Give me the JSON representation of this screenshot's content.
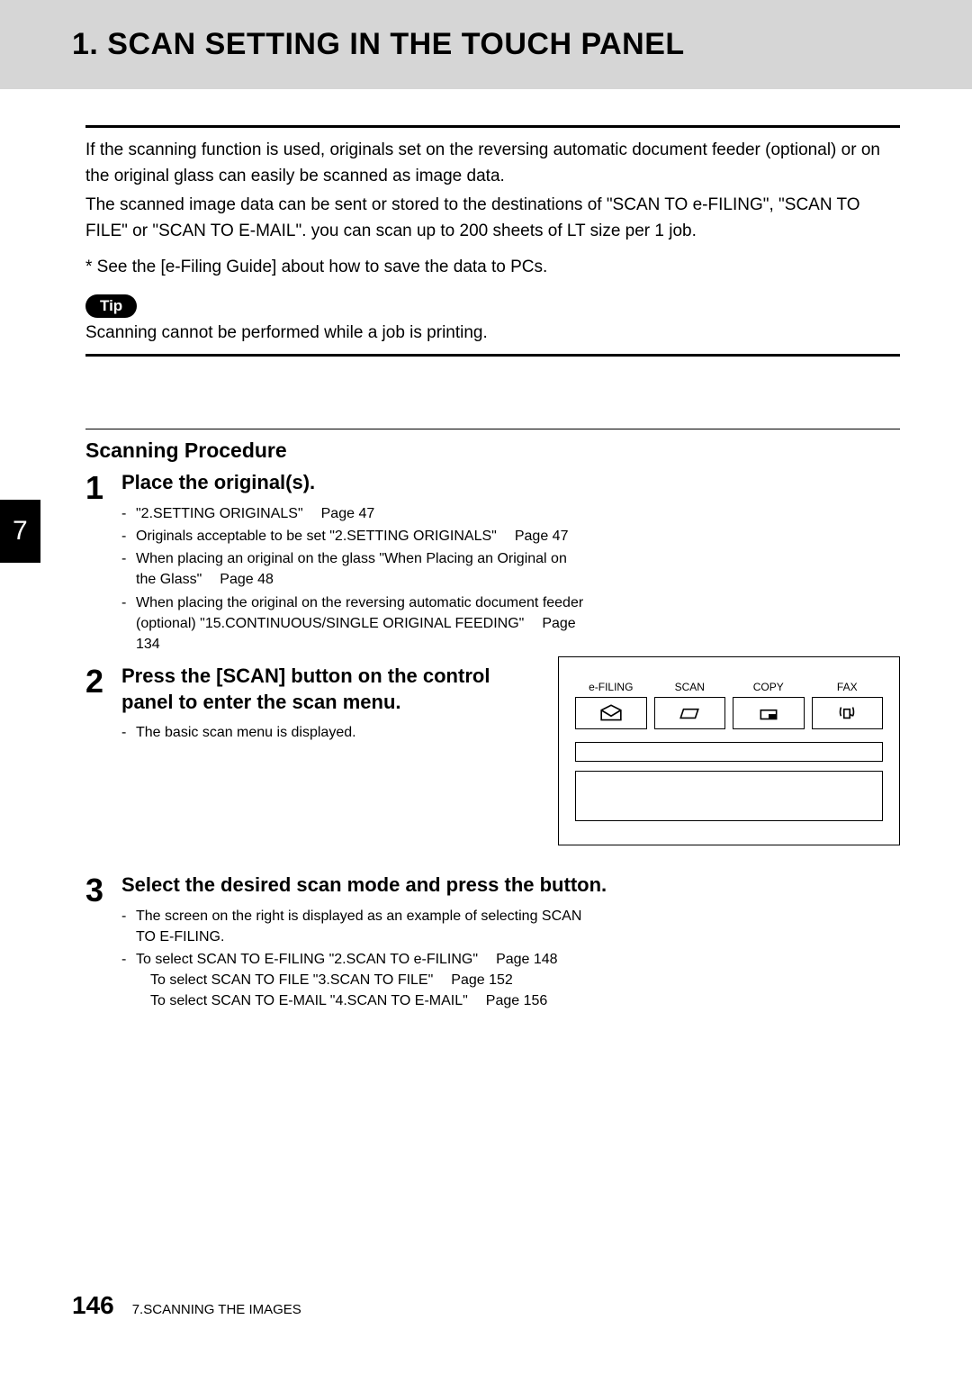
{
  "header": {
    "title": "1. SCAN SETTING IN THE TOUCH PANEL"
  },
  "intro": {
    "p1": "If the scanning function is used, originals set on the reversing automatic document feeder (optional) or on the original glass can easily be scanned as image data.",
    "p2": "The scanned image data can be sent or stored to the destinations of \"SCAN TO e-FILING\", \"SCAN TO FILE\" or \"SCAN TO E-MAIL\". you can scan up to 200 sheets of LT size per 1 job.",
    "footnote": "*  See the [e-Filing Guide] about how to save the data to PCs."
  },
  "tip": {
    "label": "Tip",
    "text": "Scanning cannot be performed while a job is printing."
  },
  "section": {
    "title": "Scanning Procedure"
  },
  "steps": {
    "s1": {
      "num": "1",
      "title": "Place the original(s).",
      "b1a": "\"2.SETTING ORIGINALS\"",
      "b1b": "Page 47",
      "b2a": "Originals acceptable to be set \"2.SETTING ORIGINALS\"",
      "b2b": "Page 47",
      "b3a": "When placing an original on the glass \"When Placing an Original on the Glass\"",
      "b3b": "Page 48",
      "b4a": "When placing the original on the reversing automatic document feeder (optional) \"15.CONTINUOUS/SINGLE ORIGINAL FEEDING\"",
      "b4b": "Page 134"
    },
    "s2": {
      "num": "2",
      "title": "Press the [SCAN] button on the control panel to enter the scan menu.",
      "b1": "The basic scan menu is displayed."
    },
    "s3": {
      "num": "3",
      "title": "Select the desired scan mode and press the button.",
      "b1": "The screen on the right is displayed as an example of selecting SCAN TO E-FILING.",
      "b2a": "To select SCAN TO E-FILING \"2.SCAN TO e-FILING\"",
      "b2b": "Page 148",
      "b3a": "To select SCAN TO FILE \"3.SCAN TO FILE\"",
      "b3b": "Page 152",
      "b4a": "To select SCAN TO E-MAIL \"4.SCAN TO E-MAIL\"",
      "b4b": "Page 156"
    }
  },
  "panel": {
    "btn1": "e-FILING",
    "btn2": "SCAN",
    "btn3": "COPY",
    "btn4": "FAX"
  },
  "chapter": {
    "num": "7"
  },
  "footer": {
    "page": "146",
    "text": "7.SCANNING THE IMAGES"
  }
}
